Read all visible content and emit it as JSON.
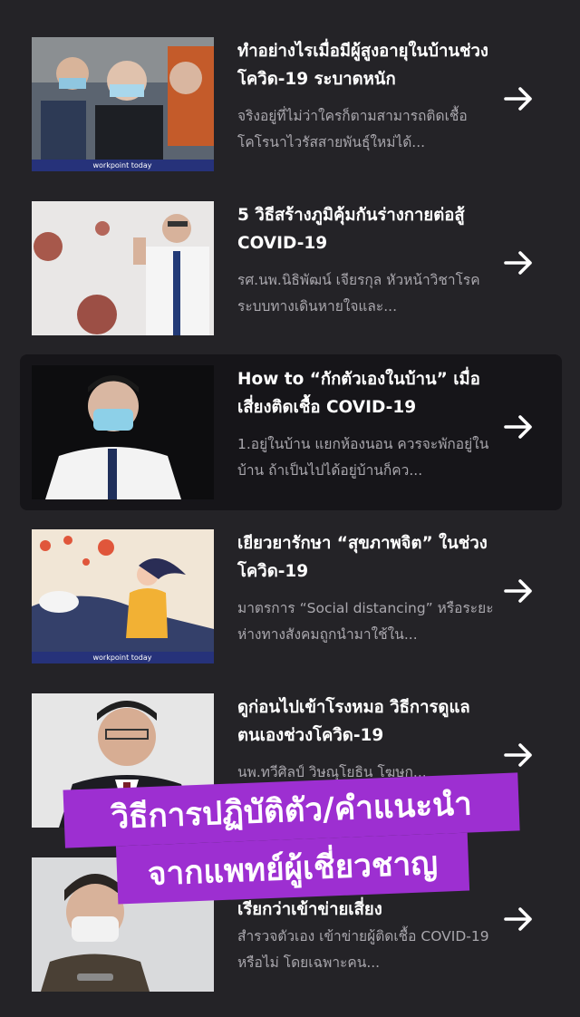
{
  "articles": [
    {
      "title": "ทำอย่างไรเมื่อมีผู้สูงอายุในบ้านช่วงโควิด-19 ระบาดหนัก",
      "description": "จริงอยู่ที่ไม่ว่าใครก็ตามสามารถติดเชื้อโคโรนาไวรัสสายพันธุ์ใหม่ได้...",
      "thumb_caption": "workpoint today"
    },
    {
      "title": "5 วิธีสร้างภูมิคุ้มกันร่างกายต่อสู้ COVID-19",
      "description": "รศ.นพ.นิธิพัฒน์ เจียรกุล หัวหน้าวิชาโรคระบบทางเดินหายใจและ..."
    },
    {
      "title": "How to “กักตัวเองในบ้าน” เมื่อเสี่ยงติดเชื้อ COVID-19",
      "description": "1.อยู่ในบ้าน แยกห้องนอน ควรจะพักอยู่ในบ้าน ถ้าเป็นไปได้อยู่บ้านก็คว..."
    },
    {
      "title": "เยียวยารักษา “สุขภาพจิต” ในช่วงโควิด-19",
      "description": "มาตรการ “Social distancing” หรือระยะห่างทางสังคมถูกนำมาใช้ใน...",
      "thumb_caption": "workpoint today"
    },
    {
      "title": "ดูก่อนไปเข้าโรงหมอ วิธีการดูแลตนเองช่วงโควิด-19",
      "description": "นพ.ทวีศิลป์ วิษณุโยธิน โฆษก..."
    },
    {
      "title": "เรียกว่าเข้าข่ายเสี่ยง",
      "description": "สำรวจตัวเอง เข้าข่ายผู้ติดเชื้อ COVID-19 หรือไม่ โดยเฉพาะคน..."
    }
  ],
  "banner": {
    "line1": "วิธีการปฏิบัติตัว/คำแนะนำ",
    "line2": "จากแพทย์ผู้เชี่ยวชาญ"
  },
  "colors": {
    "background": "#242327",
    "active_item": "#161519",
    "banner": "#9d2fd1"
  },
  "icons": {
    "arrow": "arrow-right-icon"
  }
}
